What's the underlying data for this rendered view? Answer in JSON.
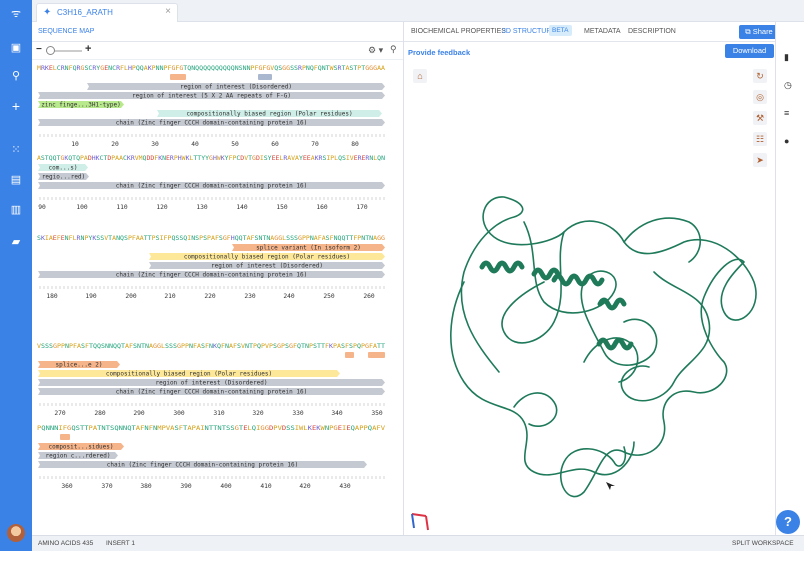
{
  "tab": {
    "title": "C3H16_ARATH"
  },
  "sequence_panel": {
    "title": "SEQUENCE MAP"
  },
  "right_tabs": {
    "biochemical": "BIOCHEMICAL PROPERTIES",
    "structure": "3D STRUCTURE",
    "beta": "BETA",
    "metadata": "METADATA",
    "description": "DESCRIPTION"
  },
  "actions": {
    "share": "Share",
    "feedback": "Provide feedback",
    "download": "Download"
  },
  "status": {
    "amino_acids": "AMINO ACIDS 435",
    "insert": "INSERT 1",
    "split": "SPLIT WORKSPACE"
  },
  "help_label": "?",
  "colors": {
    "accent": "#3b82e6",
    "protein": "#1f7a5a",
    "region_grey": "#c5c9d1",
    "zinc_green": "#b9e98d",
    "comp_teal": "#cfeee7",
    "comp_yellow": "#fde89a",
    "splice_orange": "#f6b48a"
  },
  "sequence_rows": [
    {
      "sequence": "MRKELCRNFQRGSCRYGENCRFLHPQQAKPNNPFGFGTQNQQQQQQQQQQNSNNPFGFGVQSGGSSRPNQFQNTWSRTASTPTGGGAA",
      "ticks": [
        "10",
        "20",
        "30",
        "40",
        "50",
        "60",
        "70",
        "80"
      ],
      "features": [
        {
          "label": "region of interest (Disordered)",
          "type": "grey"
        },
        {
          "label": "region of interest (5 X 2 AA repeats of F-G)",
          "type": "grey"
        },
        {
          "label": "zinc finge...3H1-type)",
          "type": "green"
        },
        {
          "label": "compositionally biased region (Polar residues)",
          "type": "teal"
        },
        {
          "label": "chain (Zinc finger CCCH domain-containing protein 16)",
          "type": "grey"
        }
      ]
    },
    {
      "sequence": "ASTQQTGKQTQPADHKCTDPAACKRVMQDDFKNERPHWKLTTYYGHWKYFPCDVTGDISYEELRAVAYEEAKRSIPLQSIVERERNLQN",
      "ticks": [
        "90",
        "100",
        "110",
        "120",
        "130",
        "140",
        "150",
        "160",
        "170"
      ],
      "features": [
        {
          "label": "com...s)",
          "type": "teal"
        },
        {
          "label": "regio...red)",
          "type": "grey"
        },
        {
          "label": "chain (Zinc finger CCCH domain-containing protein 16)",
          "type": "grey"
        }
      ]
    },
    {
      "sequence": "SKIAEFENFLRNPYKSSVTANQSPFAATTPSIFPQSSQINSPSPAFSGFHQQTAFSNTNAGGLSSSGPPNAFASFNQQTTFPNTNAGG",
      "ticks": [
        "180",
        "190",
        "200",
        "210",
        "220",
        "230",
        "240",
        "250",
        "260"
      ],
      "features": [
        {
          "label": "splice variant (In isoform 2)",
          "type": "orange"
        },
        {
          "label": "compositionally biased region (Polar residues)",
          "type": "yellow"
        },
        {
          "label": "region of interest (Disordered)",
          "type": "grey"
        },
        {
          "label": "chain (Zinc finger CCCH domain-containing protein 16)",
          "type": "grey"
        }
      ]
    },
    {
      "sequence": "VSSSGPPNPFASFTQQSNNQQTAFSNTNAGGLSSSGPPNFASFNKQFNAFSVNTPQPVPSGPSGFQTNPSTTFKPASFSPQPGFATT",
      "ticks": [
        "270",
        "280",
        "290",
        "300",
        "310",
        "320",
        "330",
        "340",
        "350"
      ],
      "features": [
        {
          "label": "splice...e 2)",
          "type": "orange"
        },
        {
          "label": "compositionally biased region (Polar residues)",
          "type": "yellow"
        },
        {
          "label": "region of interest (Disordered)",
          "type": "grey"
        },
        {
          "label": "chain (Zinc finger CCCH domain-containing protein 16)",
          "type": "grey"
        }
      ]
    },
    {
      "sequence": "PQNNNIFGQSTTPATNTSQNNQTAFNFNMPVASFTAPAINTTNTSSGTELQIGGDPVDSSIWLKEKWNPGEIEQAPPQAFV",
      "ticks": [
        "360",
        "370",
        "380",
        "390",
        "400",
        "410",
        "420",
        "430"
      ],
      "features": [
        {
          "label": "composit...sidues)",
          "type": "orange"
        },
        {
          "label": "region c...rdered)",
          "type": "grey"
        },
        {
          "label": "chain (Zinc finger CCCH domain-containing protein 16)",
          "type": "grey"
        }
      ]
    }
  ]
}
